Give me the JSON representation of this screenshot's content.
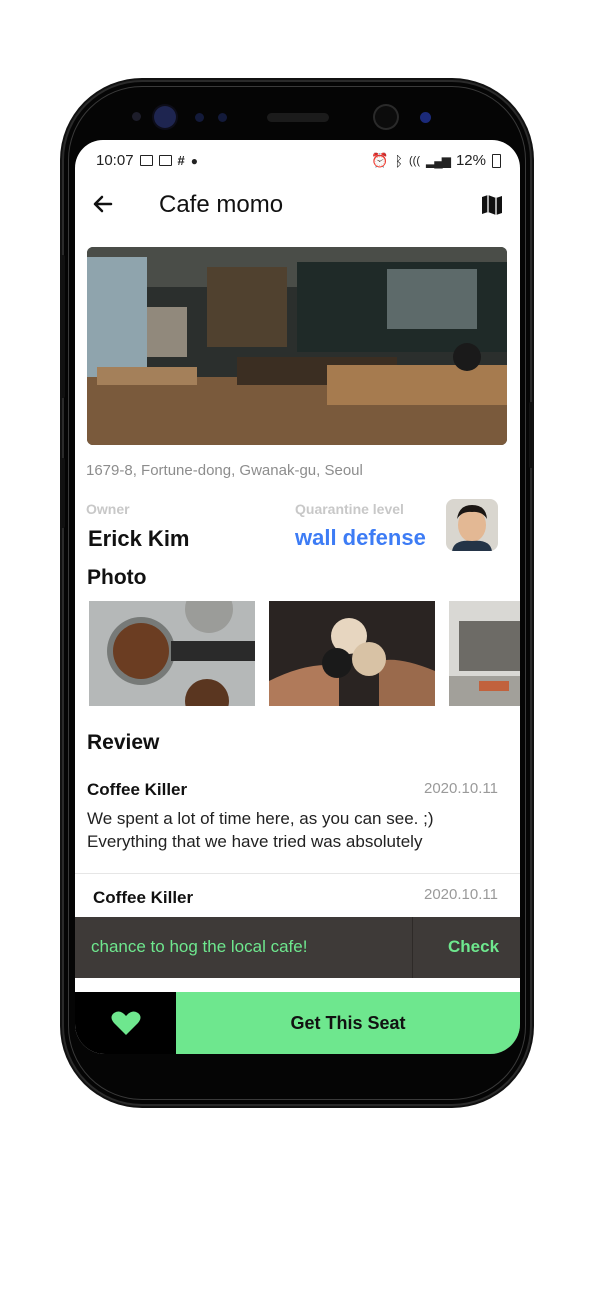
{
  "status_bar": {
    "time": "10:07",
    "battery": "12%"
  },
  "header": {
    "title": "Cafe momo",
    "back_icon": "arrow-left-icon",
    "map_icon": "map-icon"
  },
  "cafe": {
    "address": "1679-8, Fortune-dong, Gwanak-gu, Seoul",
    "owner_label": "Owner",
    "owner_name": "Erick Kim",
    "quarantine_label": "Quarantine level",
    "quarantine_value": "wall defense"
  },
  "photo_section": {
    "title": "Photo"
  },
  "review_section": {
    "title": "Review",
    "reviews": [
      {
        "user": "Coffee Killer",
        "date": "2020.10.11",
        "text_line1": "We spent a lot of time here, as you can see. ;)",
        "text_line2": "Everything that we have tried was absolutely"
      },
      {
        "user": "Coffee Killer",
        "date": "2020.10.11"
      }
    ]
  },
  "snackbar": {
    "message": "chance to hog the local cafe!",
    "action": "Check"
  },
  "bottom_bar": {
    "cta_label": "Get This Seat",
    "favorite_icon": "heart-icon"
  },
  "colors": {
    "accent_green": "#6ee78e",
    "quarantine_blue": "#3d7cf5",
    "snackbar_bg": "#3e3a38"
  }
}
